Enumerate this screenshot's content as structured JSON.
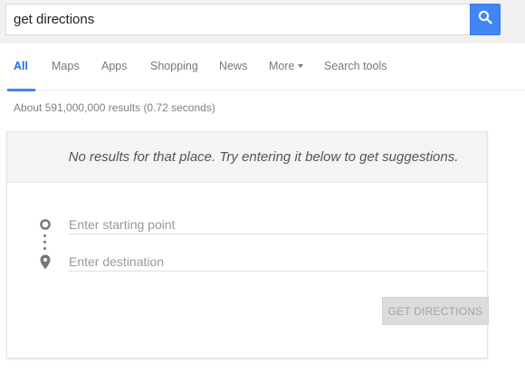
{
  "search": {
    "query": "get directions",
    "button_icon": "search-icon",
    "button_color": "#4285f4"
  },
  "tabs": [
    {
      "label": "All",
      "active": true
    },
    {
      "label": "Maps"
    },
    {
      "label": "Apps"
    },
    {
      "label": "Shopping"
    },
    {
      "label": "News"
    },
    {
      "label": "More",
      "icon": "chevron-down-icon"
    },
    {
      "label": "Search tools"
    }
  ],
  "result_stats": "About 591,000,000 results (0.72 seconds)",
  "directions_card": {
    "message": "No results for that place. Try entering it below to get suggestions.",
    "start_placeholder": "Enter starting point",
    "destination_placeholder": "Enter destination",
    "start_icon": "origin-circle-icon",
    "destination_icon": "location-pin-icon",
    "button_label": "GET DIRECTIONS"
  }
}
